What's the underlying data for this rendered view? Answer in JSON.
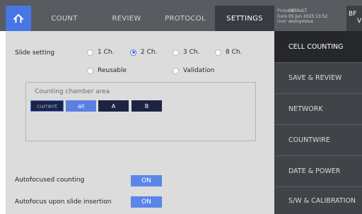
{
  "tabs": {
    "count": "COUNT",
    "review": "REVIEW",
    "protocol": "PROTOCOL",
    "settings": "SETTINGS"
  },
  "info": {
    "protocol_key": "Protocol",
    "protocol_value": "DEFAULT",
    "date_key": "Date",
    "date_value": "05 Jun 2023 13:52",
    "user_key": "User",
    "user_value": "anonymous"
  },
  "mode_badge": {
    "line1": "BF",
    "line2": "V"
  },
  "slide_setting": {
    "label": "Slide setting",
    "options": [
      "1 Ch.",
      "2 Ch.",
      "3 Ch.",
      "8 Ch."
    ],
    "selected": "2 Ch.",
    "options_row2": [
      "Reusable",
      "Validation"
    ]
  },
  "chamber_area": {
    "title": "Counting chamber area",
    "buttons": [
      "current",
      "all",
      "A",
      "B"
    ],
    "selected": "all"
  },
  "autofocus": {
    "counting_label": "Autofocused counting",
    "counting_value": "ON",
    "insertion_label": "Autofocus upon slide insertion",
    "insertion_value": "ON"
  },
  "menu": [
    "CELL COUNTING",
    "SAVE & REVIEW",
    "NETWORK",
    "COUNTWIRE",
    "DATE & POWER",
    "S/W & CALIBRATION"
  ],
  "menu_active": "CELL COUNTING",
  "colors": {
    "accent": "#4b74e0",
    "toggle_on": "#5b86e8",
    "topbar": "#585b60",
    "sidebar": "#404348",
    "panel": "#dcdcdc"
  },
  "icons": {
    "home": "home-icon"
  }
}
